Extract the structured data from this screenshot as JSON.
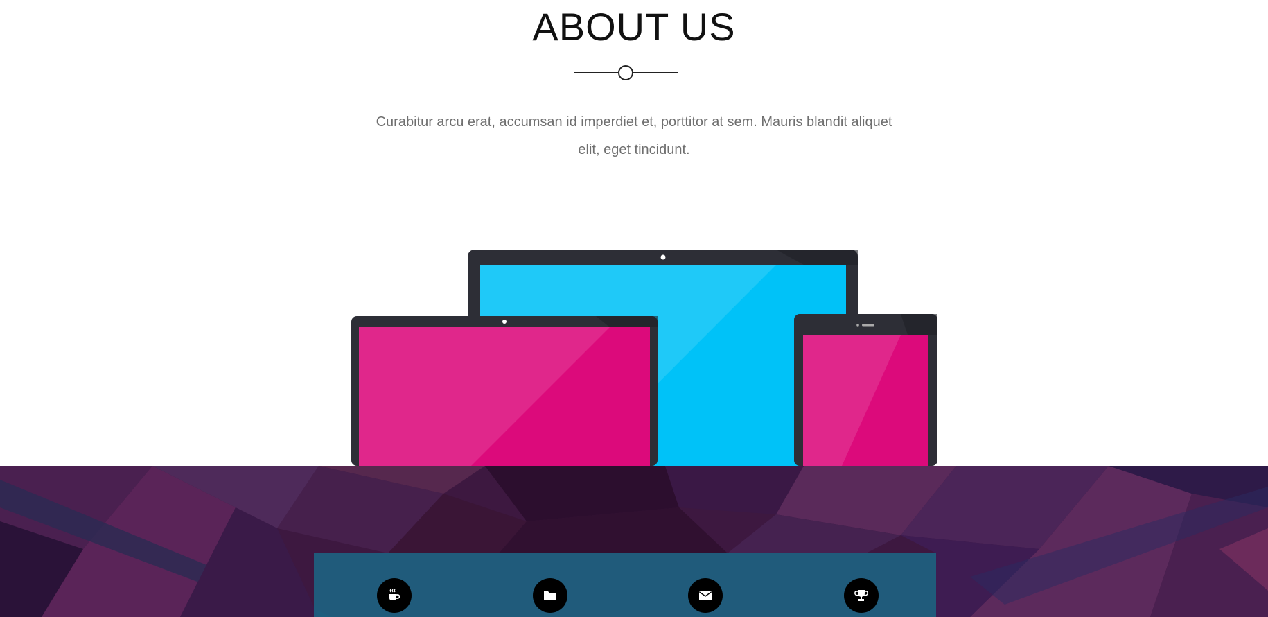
{
  "about": {
    "title": "ABOUT US",
    "text": "Curabitur arcu erat, accumsan id imperdiet et, porttitor at sem. Mauris blandit aliquet elit, eget tincidunt."
  },
  "illustration": {
    "devices": [
      "desktop-monitor",
      "laptop",
      "tablet"
    ],
    "colors": {
      "bezel": "#2d2e36",
      "cyan_screen": "#00c2f8",
      "pink_screen": "#dc0a7b"
    }
  },
  "features": {
    "icons": [
      "coffee-icon",
      "folder-icon",
      "envelope-icon",
      "trophy-icon"
    ],
    "colors": {
      "panel": "#1d6587",
      "icon_bg": "#000000",
      "icon_fg": "#ffffff",
      "section_bg": "#3d1840"
    }
  }
}
